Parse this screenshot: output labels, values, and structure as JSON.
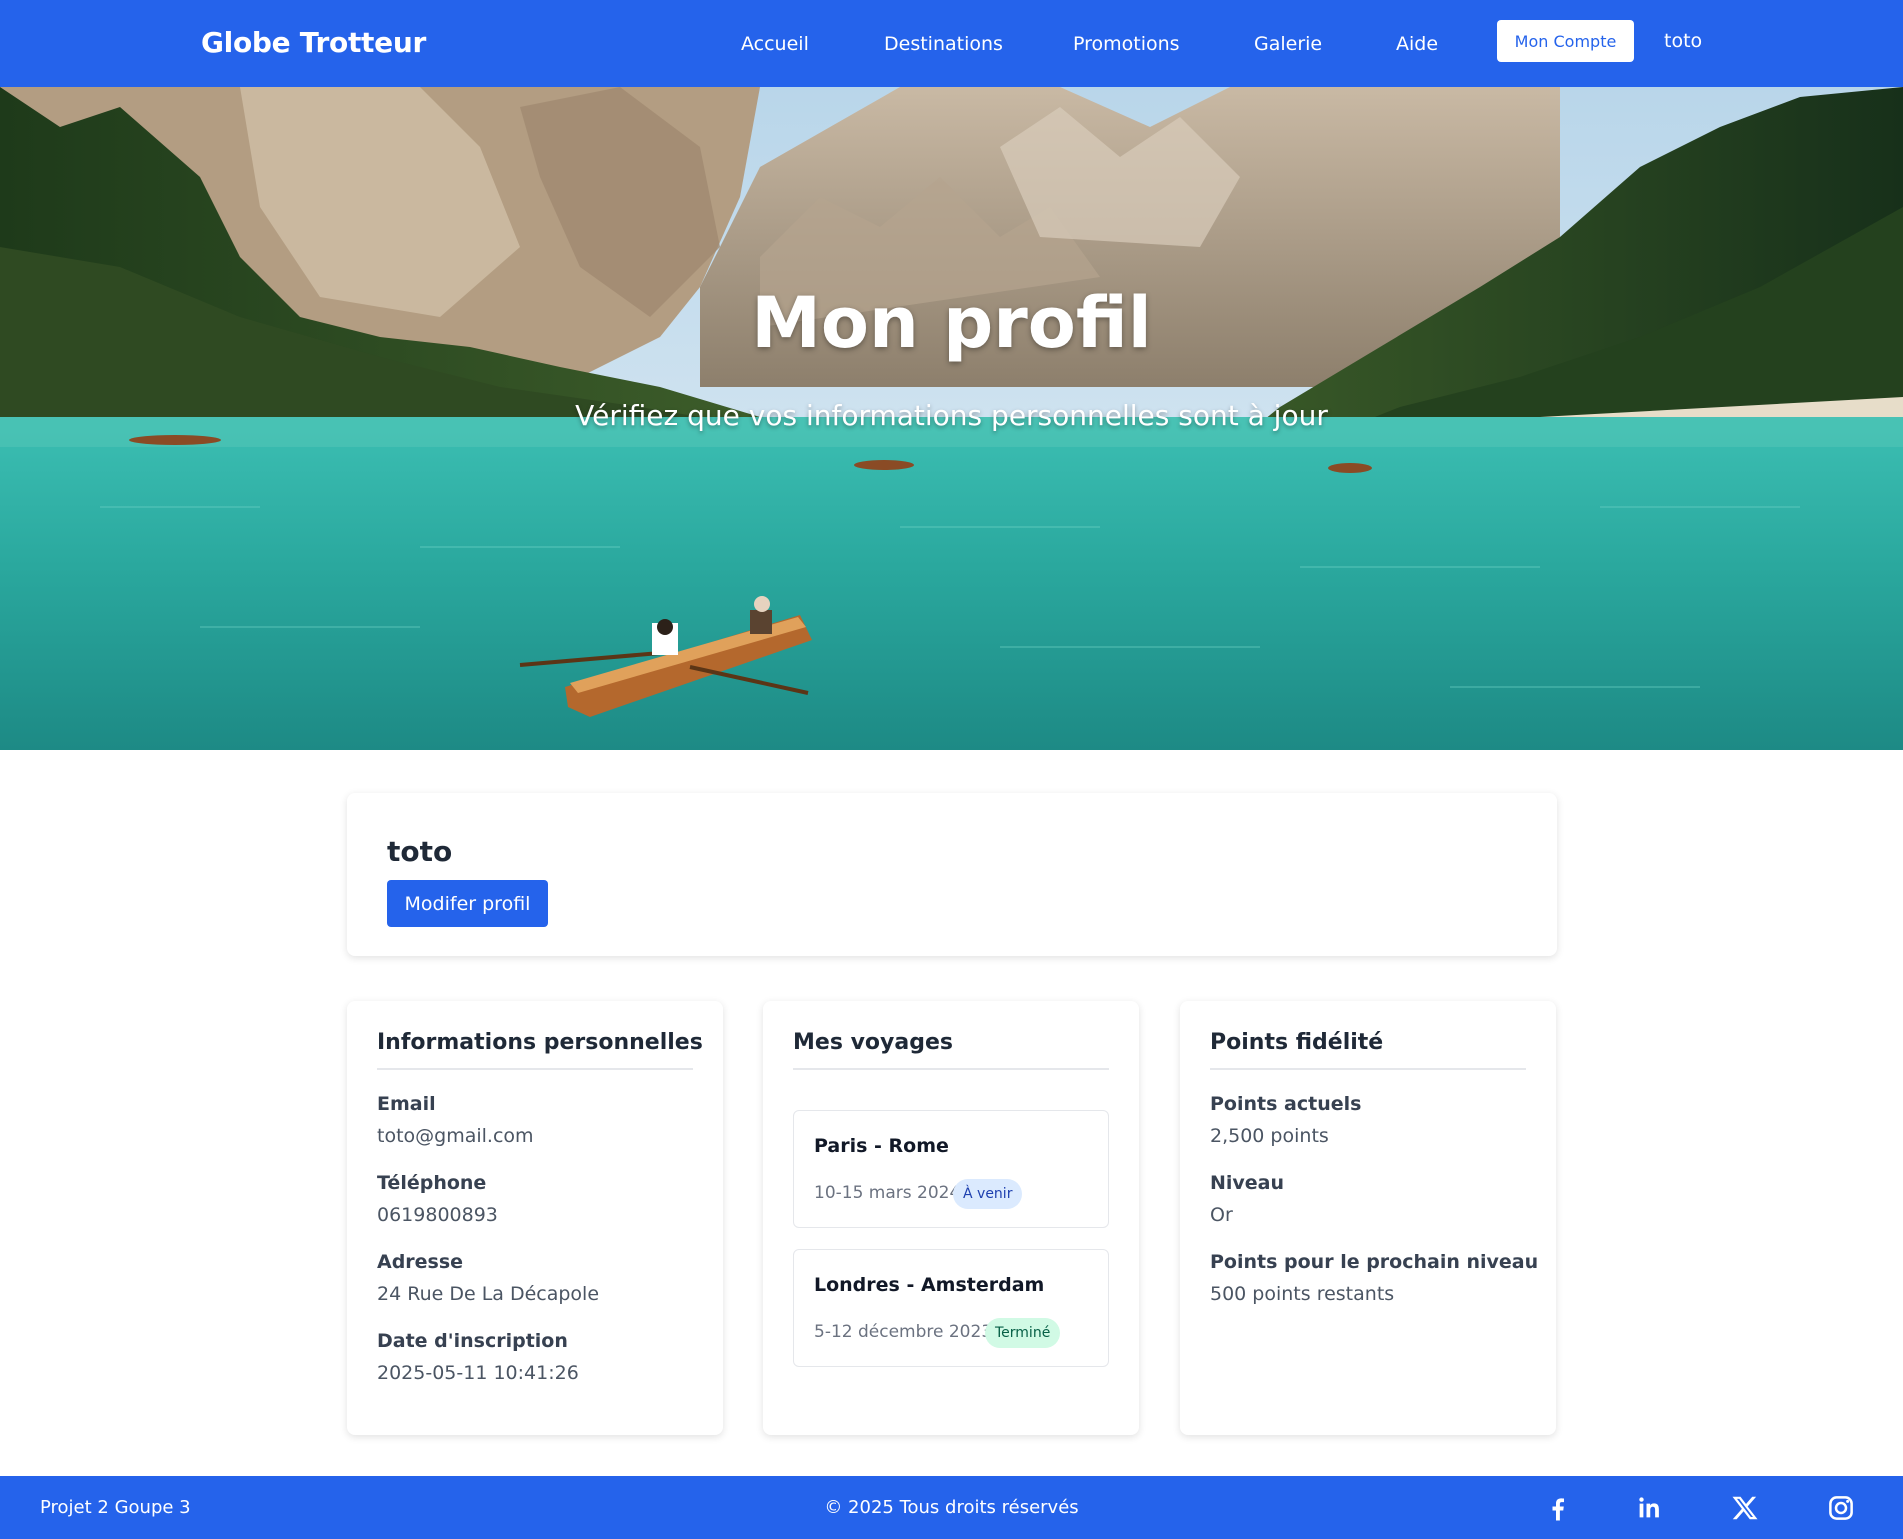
{
  "header": {
    "brand": "Globe Trotteur",
    "nav": [
      "Accueil",
      "Destinations",
      "Promotions",
      "Galerie",
      "Aide"
    ],
    "account_button": "Mon Compte",
    "username": "toto"
  },
  "hero": {
    "title": "Mon profil",
    "subtitle": "Vérifiez que vos informations personnelles sont à jour"
  },
  "profile": {
    "name": "toto",
    "edit_button": "Modifer profil"
  },
  "personal_info": {
    "title": "Informations personnelles",
    "fields": [
      {
        "label": "Email",
        "value": "toto@gmail.com"
      },
      {
        "label": "Téléphone",
        "value": "0619800893"
      },
      {
        "label": "Adresse",
        "value": "24 Rue De La Décapole"
      },
      {
        "label": "Date d'inscription",
        "value": "2025-05-11 10:41:26"
      }
    ]
  },
  "trips": {
    "title": "Mes voyages",
    "items": [
      {
        "route": "Paris - Rome",
        "dates": "10-15 mars 2024",
        "status": "À venir"
      },
      {
        "route": "Londres - Amsterdam",
        "dates": "5-12 décembre 2023",
        "status": "Terminé"
      }
    ]
  },
  "loyalty": {
    "title": "Points fidélité",
    "fields": [
      {
        "label": "Points actuels",
        "value": "2,500 points"
      },
      {
        "label": "Niveau",
        "value": "Or"
      },
      {
        "label": "Points pour le prochain niveau",
        "value": "500 points restants"
      }
    ]
  },
  "footer": {
    "left": "Projet 2 Goupe 3",
    "center": "© 2025 Tous droits réservés",
    "social_icons": [
      "facebook-icon",
      "linkedin-icon",
      "x-icon",
      "instagram-icon"
    ]
  },
  "colors": {
    "primary": "#2563eb",
    "badge_upcoming_bg": "#dbeafe",
    "badge_done_bg": "#d1fae5"
  }
}
